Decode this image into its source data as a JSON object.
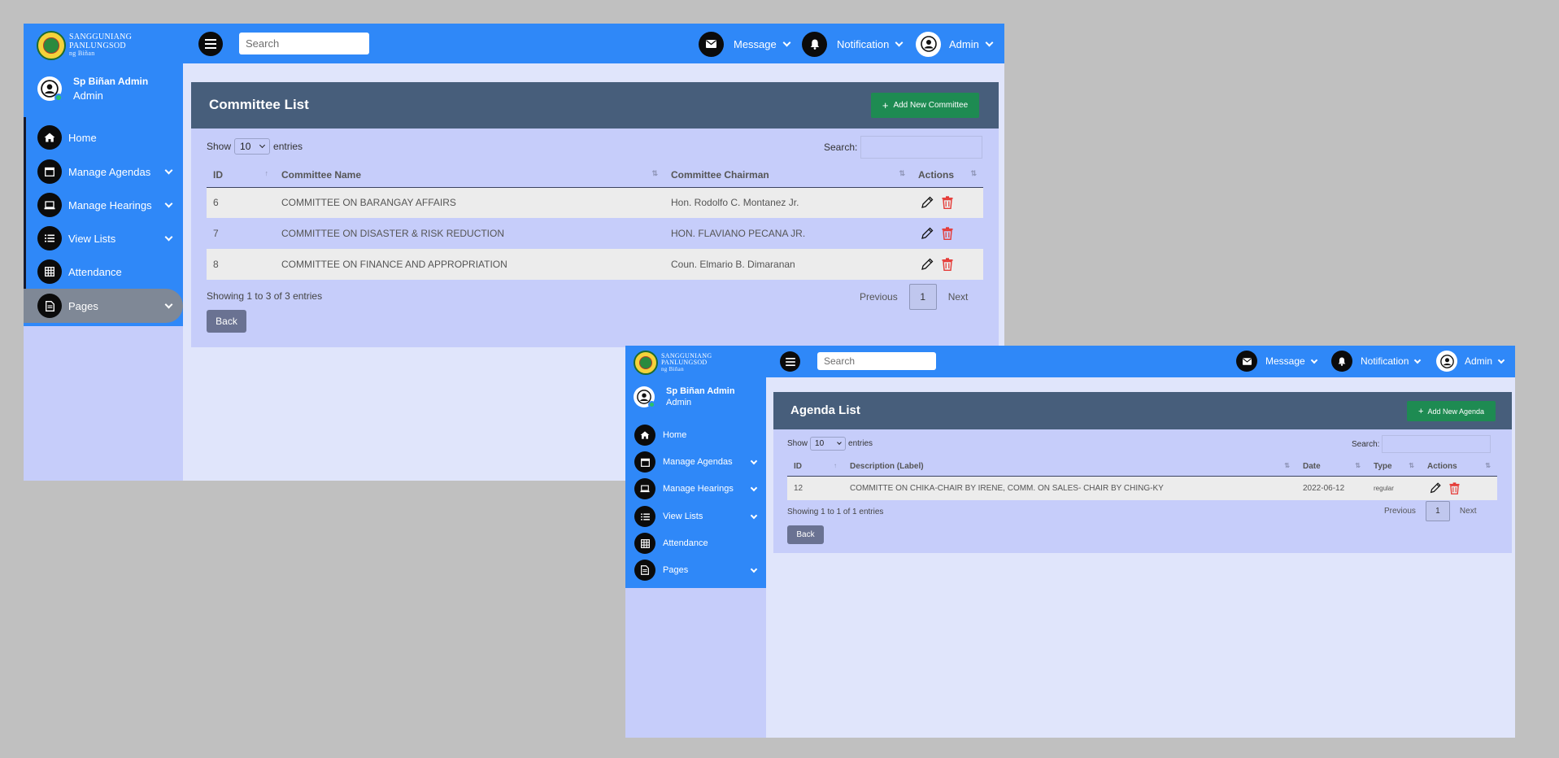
{
  "brand": {
    "line1": "SANGGUNIANG",
    "line2": "PANLUNGSOD",
    "line3": "ng Biñan"
  },
  "topbar": {
    "search_placeholder": "Search",
    "message_label": "Message",
    "notification_label": "Notification",
    "admin_label": "Admin"
  },
  "user": {
    "name": "Sp Biñan Admin",
    "role": "Admin"
  },
  "sidebar": {
    "items": [
      {
        "label": "Home",
        "icon": "home-icon"
      },
      {
        "label": "Manage Agendas",
        "icon": "calendar-icon"
      },
      {
        "label": "Manage Hearings",
        "icon": "laptop-icon"
      },
      {
        "label": "View Lists",
        "icon": "list-icon"
      },
      {
        "label": "Attendance",
        "icon": "table-icon"
      },
      {
        "label": "Pages",
        "icon": "file-icon"
      }
    ]
  },
  "committee": {
    "title": "Committee List",
    "add_label": "Add New Committee",
    "show_label": "Show",
    "entries_value": "10",
    "entries_label": "entries",
    "search_label": "Search:",
    "columns": [
      "ID",
      "Committee Name",
      "Committee Chairman",
      "Actions"
    ],
    "rows": [
      {
        "id": "6",
        "name": "COMMITTEE ON BARANGAY AFFAIRS",
        "chairman": "Hon. Rodolfo C. Montanez Jr."
      },
      {
        "id": "7",
        "name": "COMMITTEE ON DISASTER & RISK REDUCTION",
        "chairman": "HON. FLAVIANO PECANA JR."
      },
      {
        "id": "8",
        "name": "COMMITTEE ON FINANCE AND APPROPRIATION",
        "chairman": "Coun. Elmario B. Dimaranan"
      }
    ],
    "info": "Showing 1 to 3 of 3 entries",
    "prev": "Previous",
    "page": "1",
    "next": "Next",
    "back": "Back"
  },
  "agenda": {
    "title": "Agenda List",
    "add_label": "Add New Agenda",
    "show_label": "Show",
    "entries_value": "10",
    "entries_label": "entries",
    "search_label": "Search:",
    "columns": [
      "ID",
      "Description (Label)",
      "Date",
      "Type",
      "Actions"
    ],
    "rows": [
      {
        "id": "12",
        "description": "COMMITTE ON CHIKA-CHAIR BY IRENE, COMM. ON SALES- CHAIR BY CHING-KY",
        "date": "2022-06-12",
        "type": "regular"
      }
    ],
    "info": "Showing 1 to 1 of 1 entries",
    "prev": "Previous",
    "page": "1",
    "next": "Next",
    "back": "Back"
  },
  "colors": {
    "primary_blue": "#2f88f8",
    "panel_header": "#475e7b",
    "add_green": "#1e8b52",
    "delete_red": "#e53935",
    "panel_bg": "#c6cdfa"
  }
}
